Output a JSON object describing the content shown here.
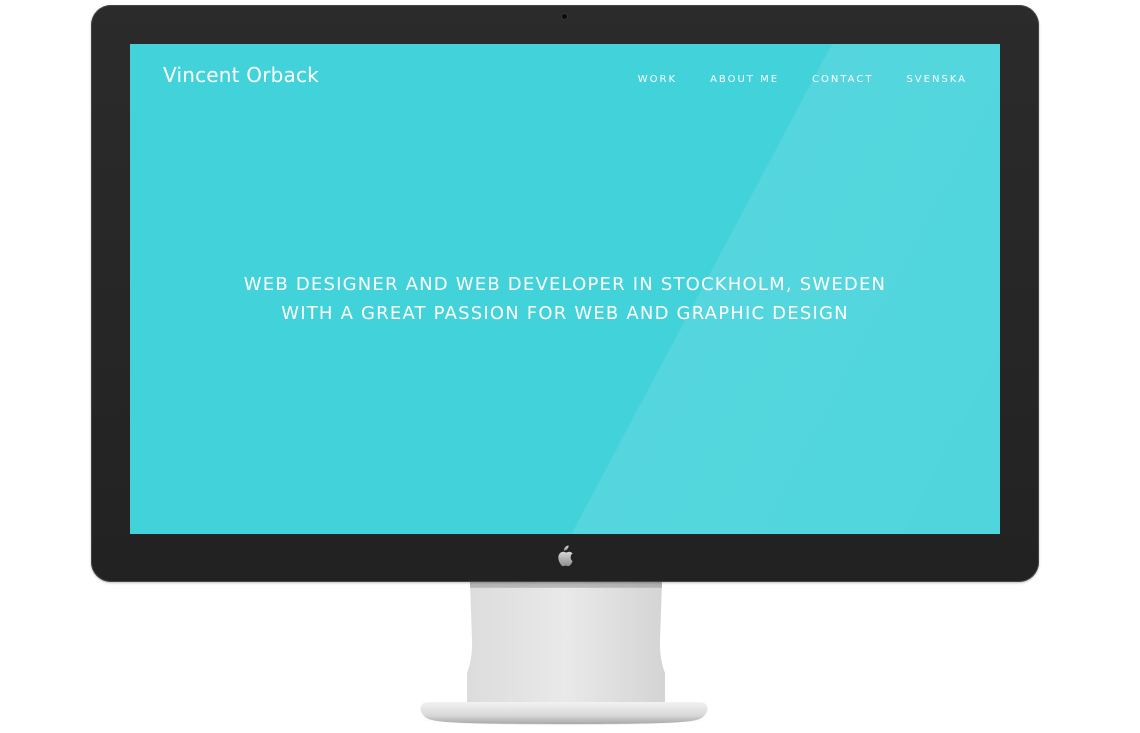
{
  "site": {
    "logo": "Vincent Orback",
    "nav": [
      "WORK",
      "ABOUT ME",
      "CONTACT",
      "SVENSKA"
    ],
    "tagline": [
      "WEB DESIGNER AND WEB DEVELOPER IN STOCKHOLM, SWEDEN",
      "WITH A GREAT PASSION FOR WEB AND GRAPHIC DESIGN"
    ]
  },
  "colors": {
    "screen_background": "#42d2da",
    "text": "#ffffff",
    "bezel": "#262626",
    "stand": "#c8c8c8"
  },
  "device": {
    "type": "desktop monitor mockup",
    "logo_icon": "apple-logo-icon"
  }
}
